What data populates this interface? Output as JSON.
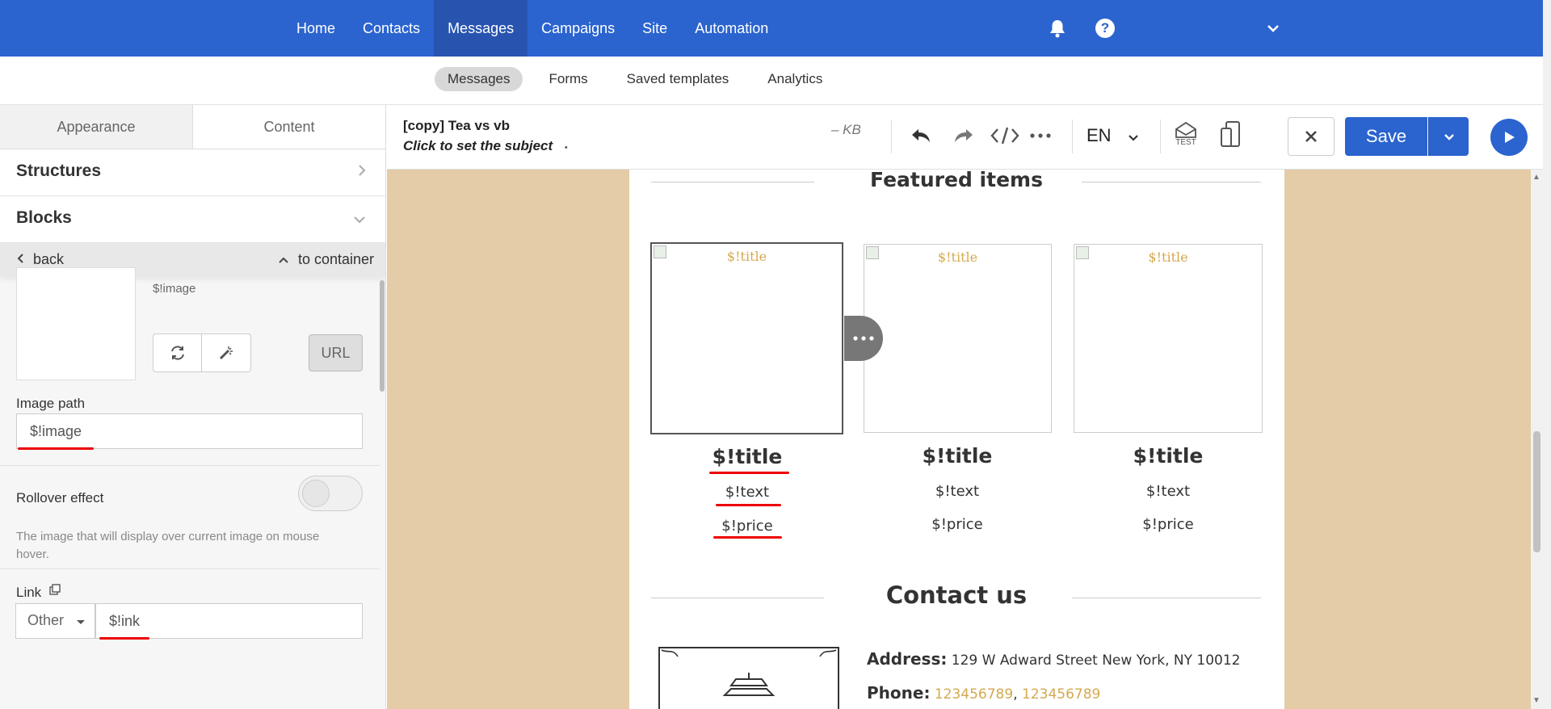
{
  "topnav": {
    "items": [
      "Home",
      "Contacts",
      "Messages",
      "Campaigns",
      "Site",
      "Automation"
    ],
    "active_index": 2,
    "icons": [
      "bell-icon",
      "help-icon",
      "chevron-down-icon"
    ],
    "color": "#2b64cf"
  },
  "subnav": {
    "items": [
      "Messages",
      "Forms",
      "Saved templates",
      "Analytics"
    ],
    "active_index": 0
  },
  "left_panel": {
    "tabs": [
      "Appearance",
      "Content"
    ],
    "active_tab": "Content",
    "structures_label": "Structures",
    "blocks_label": "Blocks",
    "back_label": "back",
    "to_container_label": "to container",
    "image_var": "$!image",
    "url_label": "URL",
    "image_path_label": "Image path",
    "image_path_value": "$!image",
    "rollover_label": "Rollover effect",
    "rollover_help": "The image that will display over current image on mouse hover.",
    "link_label": "Link",
    "link_type": "Other",
    "link_value": "$!ink"
  },
  "editor": {
    "name": "[copy] Tea vs vb",
    "subject": "Click to set the subject",
    "subject_dot": "•",
    "size": "– KB",
    "lang": "EN",
    "test_label": "TEST",
    "save_label": "Save"
  },
  "email": {
    "featured_title": "Featured items",
    "cards": [
      {
        "alt": "$!title",
        "title": "$!title",
        "text": "$!text",
        "price": "$!price"
      },
      {
        "alt": "$!title",
        "title": "$!title",
        "text": "$!text",
        "price": "$!price"
      },
      {
        "alt": "$!title",
        "title": "$!title",
        "text": "$!text",
        "price": "$!price"
      }
    ],
    "contact_title": "Contact us",
    "address_label": "Address:",
    "address_value": "129 W Adward Street New York, NY 10012",
    "phone_label": "Phone:",
    "phone_1": "123456789",
    "phone_sep": ",",
    "phone_2": "123456789",
    "accent_color": "#d4a94f",
    "background_color": "#e4cca6"
  }
}
